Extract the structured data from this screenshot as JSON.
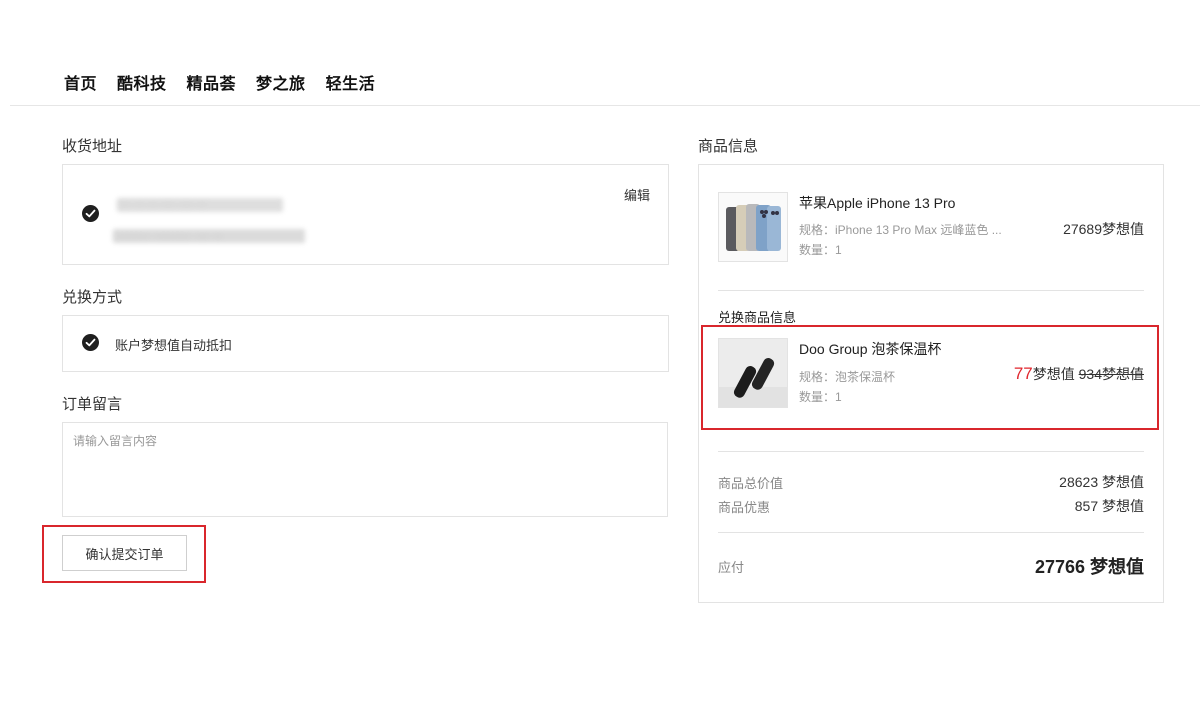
{
  "nav": {
    "items": [
      "首页",
      "酷科技",
      "精品荟",
      "梦之旅",
      "轻生活"
    ]
  },
  "address": {
    "title": "收货地址",
    "edit_label": "编辑",
    "name_blurred": "···  ·· ··  ··· ··· ··",
    "detail_blurred": "········ ········ ··· ··"
  },
  "exchange": {
    "title": "兑换方式",
    "method_label": "账户梦想值自动抵扣"
  },
  "note": {
    "title": "订单留言",
    "placeholder": "请输入留言内容",
    "value": ""
  },
  "submit": {
    "label": "确认提交订单"
  },
  "product_info": {
    "title": "商品信息",
    "main_product": {
      "name": "苹果Apple iPhone 13 Pro",
      "spec": "规格：iPhone 13 Pro Max 远峰蓝色 ...",
      "qty": "数量：1",
      "price": "27689梦想值",
      "thumb_icon": "iphone-product-image"
    },
    "exchange_title": "兑换商品信息",
    "exchange_product": {
      "name": "Doo Group 泡茶保温杯",
      "spec": "规格：泡茶保温杯",
      "qty": "数量：1",
      "price_now_number": "77",
      "price_now_unit": "梦想值",
      "price_original": "934梦想值",
      "thumb_icon": "thermos-product-image"
    },
    "summary": {
      "total_label": "商品总价值",
      "total_value": "28623 梦想值",
      "discount_label": "商品优惠",
      "discount_value": "857 梦想值",
      "payable_label": "应付",
      "payable_value": "27766 梦想值"
    }
  },
  "colors": {
    "highlight": "#d9262c",
    "price_now": "#e0262d",
    "border": "#e3e3e3"
  }
}
